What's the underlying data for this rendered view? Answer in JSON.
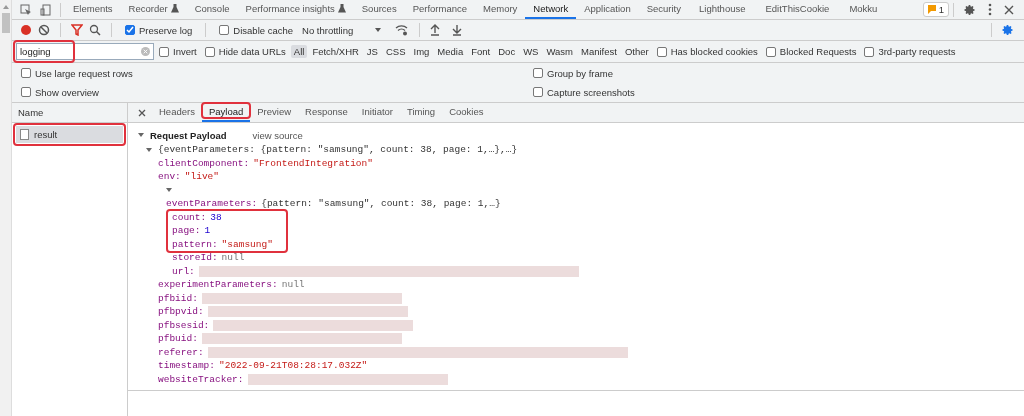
{
  "tabs": [
    {
      "label": "Elements",
      "selected": false,
      "flask": false
    },
    {
      "label": "Recorder",
      "selected": false,
      "flask": true
    },
    {
      "label": "Console",
      "selected": false,
      "flask": false
    },
    {
      "label": "Performance insights",
      "selected": false,
      "flask": true
    },
    {
      "label": "Sources",
      "selected": false,
      "flask": false
    },
    {
      "label": "Performance",
      "selected": false,
      "flask": false
    },
    {
      "label": "Memory",
      "selected": false,
      "flask": false
    },
    {
      "label": "Network",
      "selected": true,
      "flask": false
    },
    {
      "label": "Application",
      "selected": false,
      "flask": false
    },
    {
      "label": "Security",
      "selected": false,
      "flask": false
    },
    {
      "label": "Lighthouse",
      "selected": false,
      "flask": false
    },
    {
      "label": "EditThisCookie",
      "selected": false,
      "flask": false
    },
    {
      "label": "Mokku",
      "selected": false,
      "flask": false
    }
  ],
  "issues_badge": "1",
  "toolbar": {
    "recording": true,
    "filter_active": true,
    "preserve_log": {
      "label": "Preserve log",
      "checked": true
    },
    "disable_cache": {
      "label": "Disable cache",
      "checked": false
    },
    "throttling": "No throttling"
  },
  "filter": {
    "value": "logging",
    "highlighted": true,
    "checks": [
      {
        "label": "Invert",
        "checked": false
      },
      {
        "label": "Hide data URLs",
        "checked": false
      }
    ],
    "types": [
      {
        "label": "All",
        "selected": true
      },
      {
        "label": "Fetch/XHR",
        "selected": false
      },
      {
        "label": "JS",
        "selected": false
      },
      {
        "label": "CSS",
        "selected": false
      },
      {
        "label": "Img",
        "selected": false
      },
      {
        "label": "Media",
        "selected": false
      },
      {
        "label": "Font",
        "selected": false
      },
      {
        "label": "Doc",
        "selected": false
      },
      {
        "label": "WS",
        "selected": false
      },
      {
        "label": "Wasm",
        "selected": false
      },
      {
        "label": "Manifest",
        "selected": false
      },
      {
        "label": "Other",
        "selected": false
      }
    ],
    "more_checks": [
      {
        "label": "Has blocked cookies",
        "checked": false
      },
      {
        "label": "Blocked Requests",
        "checked": false
      },
      {
        "label": "3rd-party requests",
        "checked": false
      }
    ]
  },
  "options": {
    "left": [
      {
        "label": "Use large request rows",
        "checked": false
      },
      {
        "label": "Show overview",
        "checked": false
      }
    ],
    "right": [
      {
        "label": "Group by frame",
        "checked": false
      },
      {
        "label": "Capture screenshots",
        "checked": false
      }
    ]
  },
  "requests": {
    "header": "Name",
    "rows": [
      {
        "name": "result",
        "selected": true,
        "highlighted": true
      }
    ]
  },
  "detail_tabs": [
    {
      "label": "Headers",
      "selected": false,
      "highlighted": false
    },
    {
      "label": "Payload",
      "selected": true,
      "highlighted": true
    },
    {
      "label": "Preview",
      "selected": false,
      "highlighted": false
    },
    {
      "label": "Response",
      "selected": false,
      "highlighted": false
    },
    {
      "label": "Initiator",
      "selected": false,
      "highlighted": false
    },
    {
      "label": "Timing",
      "selected": false,
      "highlighted": false
    },
    {
      "label": "Cookies",
      "selected": false,
      "highlighted": false
    }
  ],
  "payload": {
    "title": "Request Payload",
    "view_source": "view source",
    "expanded": true,
    "root": {
      "kind": "object",
      "summary": "{eventParameters: {pattern: \"samsung\", count: 38, page: 1,…},…}",
      "expanded": true,
      "children": [
        {
          "kind": "string",
          "key": "clientComponent:",
          "value": "\"FrontendIntegration\""
        },
        {
          "kind": "string",
          "key": "env:",
          "value": "\"live\""
        },
        {
          "kind": "object",
          "key": "eventParameters:",
          "summary": "{pattern: \"samsung\", count: 38, page: 1,…}",
          "expanded": true,
          "children": [
            {
              "kind": "number",
              "key": "count:",
              "value": "38",
              "highlighted": true
            },
            {
              "kind": "number",
              "key": "page:",
              "value": "1",
              "highlighted": true
            },
            {
              "kind": "string",
              "key": "pattern:",
              "value": "\"samsung\"",
              "highlighted": true
            },
            {
              "kind": "null",
              "key": "storeId:",
              "value": "null"
            },
            {
              "kind": "redacted",
              "key": "url:"
            }
          ]
        },
        {
          "kind": "null",
          "key": "experimentParameters:",
          "value": "null"
        },
        {
          "kind": "redacted",
          "key": "pfbiid:"
        },
        {
          "kind": "redacted",
          "key": "pfbpvid:"
        },
        {
          "kind": "redacted",
          "key": "pfbsesid:"
        },
        {
          "kind": "redacted",
          "key": "pfbuid:"
        },
        {
          "kind": "redacted",
          "key": "referer:"
        },
        {
          "kind": "string",
          "key": "timestamp:",
          "value": "\"2022-09-21T08:28:17.032Z\""
        },
        {
          "kind": "redacted",
          "key": "websiteTracker:"
        }
      ]
    }
  }
}
